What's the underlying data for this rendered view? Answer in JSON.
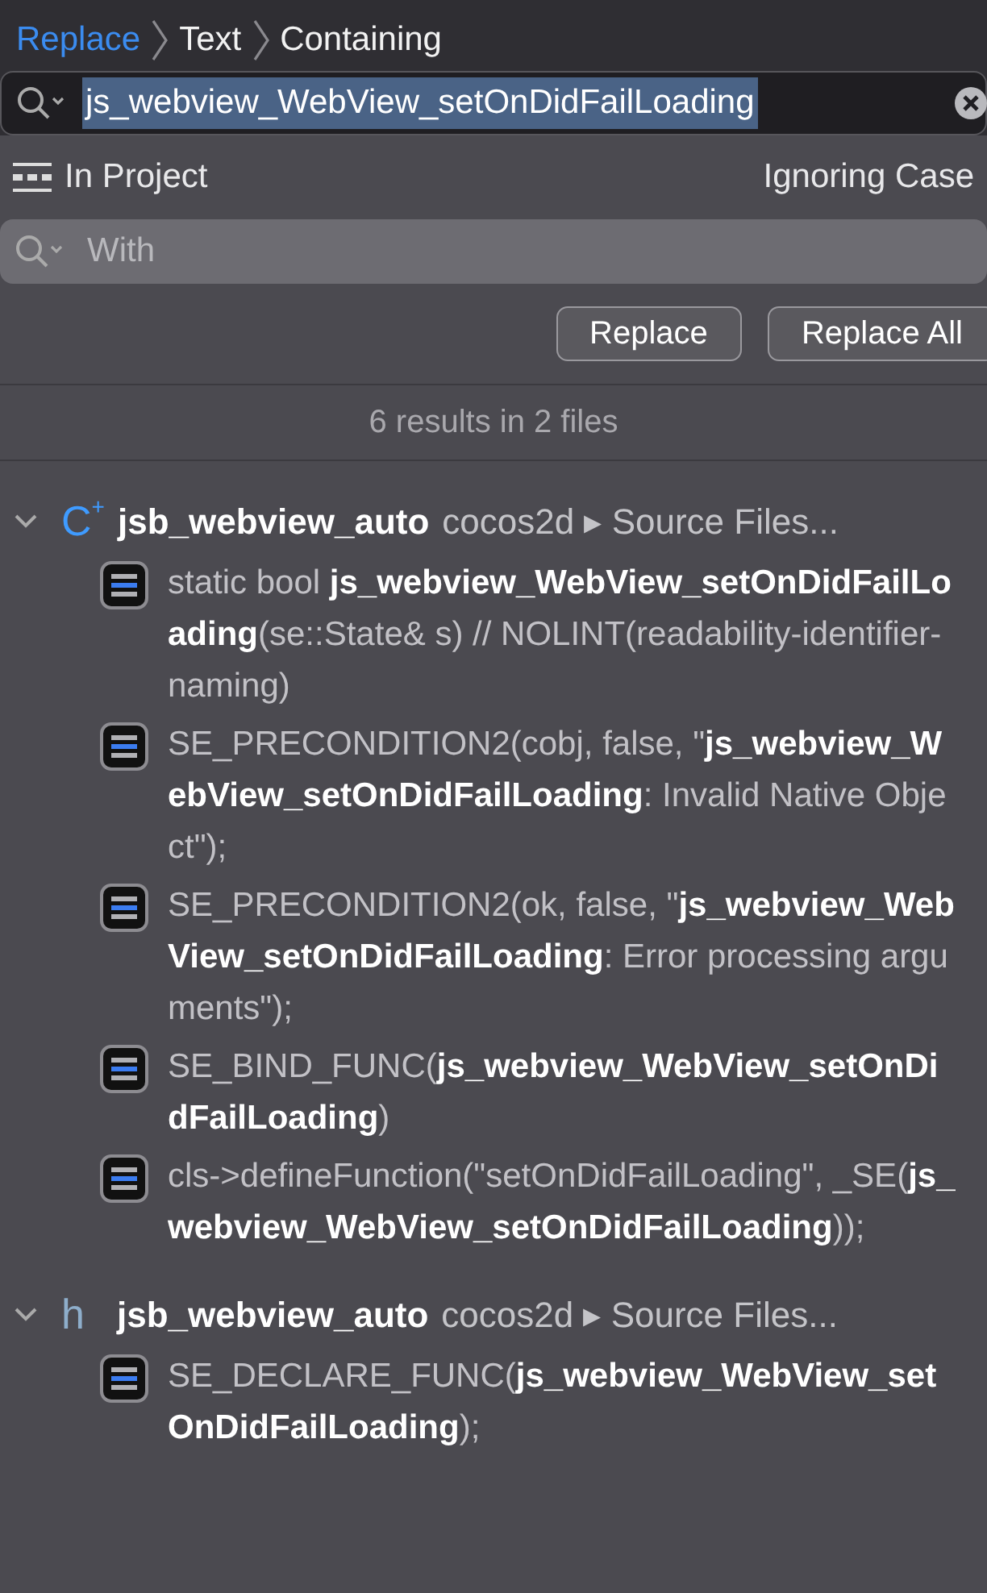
{
  "breadcrumb": [
    {
      "label": "Replace",
      "selected": true
    },
    {
      "label": "Text",
      "selected": false
    },
    {
      "label": "Containing",
      "selected": false
    }
  ],
  "search": {
    "value": "js_webview_WebView_setOnDidFailLoading",
    "text_selected": true
  },
  "scope": {
    "label": "In Project",
    "case": "Ignoring Case"
  },
  "replace_field": {
    "placeholder": "With"
  },
  "buttons": [
    "Replace",
    "Replace All"
  ],
  "summary": "6 results in 2 files",
  "groups": [
    {
      "kind": "cpp",
      "icon_text": "C$^{+}$",
      "expanded": true,
      "file": "jsb_webview_auto",
      "path": "cocos2d ▸ Source Files...",
      "results": [
        "static bool **js_webview_WebView_setOnDidFailLoading**(se::State& s) // NOLINT(readability-identifier-naming)",
        "SE_PRECONDITION2(cobj, false, \"**js_webview_WebView_setOnDidFailLoading**: Invalid Native Object\");",
        "SE_PRECONDITION2(ok, false, \"**js_webview_WebView_setOnDidFailLoading**: Error processing arguments\");",
        "SE_BIND_FUNC(**js_webview_WebView_setOnDidFailLoading**)",
        "cls->defineFunction(\"setOnDidFailLoading\", _SE(**js_webview_WebView_setOnDidFailLoading**));"
      ]
    },
    {
      "kind": "header",
      "icon_text": "h",
      "expanded": true,
      "file": "jsb_webview_auto",
      "path": "cocos2d ▸ Source Files...",
      "results": [
        "SE_DECLARE_FUNC(**js_webview_WebView_setOnDidFailLoading**);"
      ]
    }
  ]
}
